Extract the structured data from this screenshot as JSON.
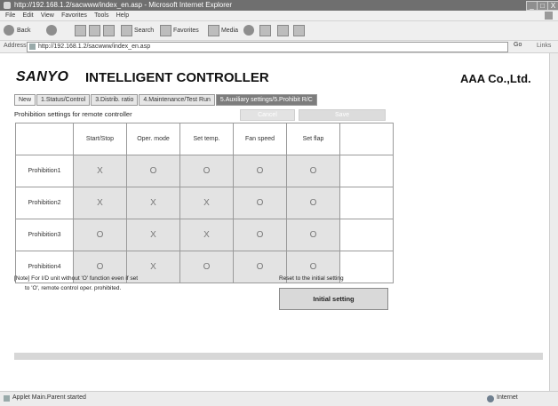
{
  "window": {
    "title": "http://192.168.1.2/sacwww/index_en.asp - Microsoft Internet Explorer",
    "minimize": "_",
    "maximize": "□",
    "close": "X"
  },
  "menu": {
    "items": [
      "File",
      "Edit",
      "View",
      "Favorites",
      "Tools",
      "Help"
    ]
  },
  "toolbar": {
    "back": "Back",
    "search": "Search",
    "favorites": "Favorites",
    "media": "Media"
  },
  "address": {
    "label": "Address",
    "url": "http://192.168.1.2/sacwww/index_en.asp",
    "go": "Go",
    "links": "Links"
  },
  "header": {
    "logo": "SANYO",
    "title": "INTELLIGENT CONTROLLER",
    "company": "AAA Co.,Ltd."
  },
  "tabs": [
    {
      "label": "New"
    },
    {
      "label": "1.Status/Control"
    },
    {
      "label": "3.Distrib. ratio"
    },
    {
      "label": "4.Maintenance/Test Run"
    },
    {
      "label": "5.Auxiliary settings/5.Prohibit R/C"
    }
  ],
  "section": {
    "label": "Prohibition settings for remote controller",
    "cancel": "Cancel",
    "save": "Save"
  },
  "grid": {
    "columns": [
      "Start/Stop",
      "Oper. mode",
      "Set temp.",
      "Fan speed",
      "Set flap"
    ],
    "rows": [
      {
        "label": "Prohibition1",
        "cells": [
          "X",
          "O",
          "O",
          "O",
          "O"
        ]
      },
      {
        "label": "Prohibition2",
        "cells": [
          "X",
          "X",
          "X",
          "O",
          "O"
        ]
      },
      {
        "label": "Prohibition3",
        "cells": [
          "O",
          "X",
          "X",
          "O",
          "O"
        ]
      },
      {
        "label": "Prohibition4",
        "cells": [
          "O",
          "X",
          "O",
          "O",
          "O"
        ]
      }
    ]
  },
  "note": {
    "line1": "[Note] For I/D unit without 'O' function even if set",
    "line2": "to 'O', remote control oper. prohibited."
  },
  "reset": {
    "label": "Reset to the initial setting",
    "button": "Initial setting"
  },
  "status": {
    "text": "Applet Main.Parent started",
    "zone": "Internet"
  }
}
